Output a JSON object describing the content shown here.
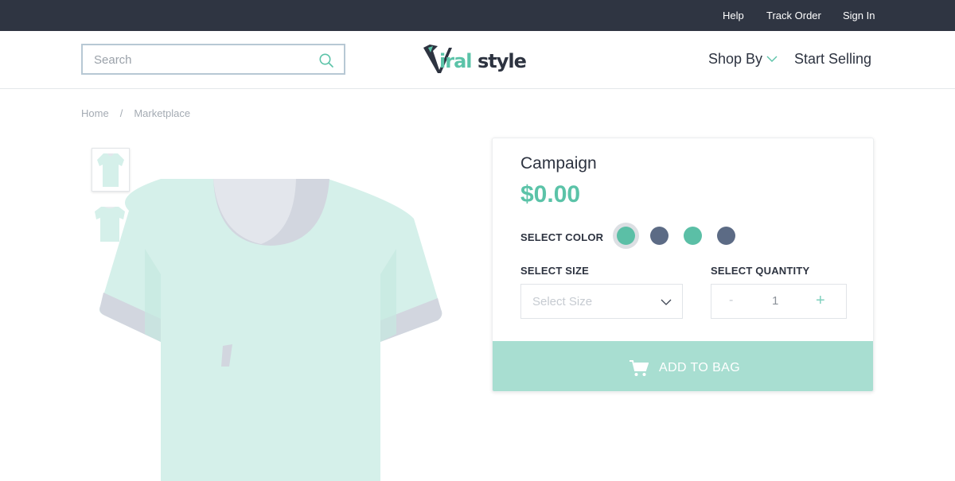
{
  "topbar": {
    "links": [
      "Help",
      "Track Order",
      "Sign In"
    ]
  },
  "header": {
    "search": {
      "placeholder": "Search",
      "value": ""
    },
    "logo_text": "Viralstyle",
    "nav": {
      "shop_by": "Shop By",
      "start_selling": "Start Selling"
    }
  },
  "breadcrumb": {
    "items": [
      "Home",
      "Marketplace"
    ],
    "separator": "/"
  },
  "product": {
    "title": "Campaign",
    "price": "$0.00",
    "color_label": "SELECT COLOR",
    "colors": [
      "#5bbfa6",
      "#5c6b85",
      "#5bbfa6",
      "#5c6b85"
    ],
    "selected_color_index": 0,
    "size_label": "SELECT SIZE",
    "size_placeholder": "Select Size",
    "quantity_label": "SELECT QUANTITY",
    "quantity": "1",
    "minus": "-",
    "plus": "+",
    "add_to_bag": "ADD TO BAG"
  },
  "colors": {
    "topbar_bg": "#2f3542",
    "accent": "#5bc3a8",
    "button_bg": "#a8ded1",
    "shirt": "#d5f0ea",
    "shirt_shadow": "#d2d6df"
  },
  "icons": {
    "search": "search-icon",
    "chevron": "chevron-down-icon",
    "cart": "cart-icon"
  }
}
